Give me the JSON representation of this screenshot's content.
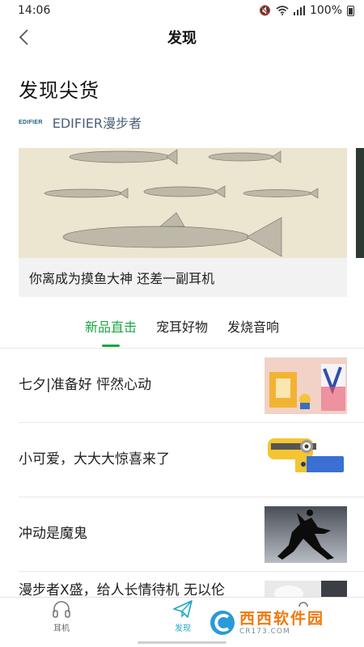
{
  "status_bar": {
    "time": "14:06",
    "battery": "100%",
    "icons": [
      "mute-icon",
      "wifi-icon",
      "signal-icon",
      "battery-icon"
    ]
  },
  "nav": {
    "title": "发现",
    "back_icon": "chevron-left-icon"
  },
  "section": {
    "title": "发现尖货"
  },
  "brand": {
    "logo_text": "EDIFIER",
    "name": "EDIFIER漫步者"
  },
  "banner": {
    "caption": "你离成为摸鱼大神 还差一副耳机"
  },
  "tabs": [
    {
      "label": "新品直击",
      "active": true
    },
    {
      "label": "宠耳好物",
      "active": false
    },
    {
      "label": "发烧音响",
      "active": false
    }
  ],
  "articles": [
    {
      "title": "七夕|准备好 怦然心动",
      "thumb": "gift-box-photo"
    },
    {
      "title": "小可爱，大大大惊喜来了",
      "thumb": "minion-speaker-photo"
    },
    {
      "title": "冲动是魔鬼",
      "thumb": "jumping-silhouette-photo"
    },
    {
      "title": "漫步者X盛，给人长情待机 无以伦",
      "thumb": "white-earbuds-photo"
    }
  ],
  "bottom_nav": [
    {
      "label": "耳机",
      "icon": "headphones-icon",
      "active": false
    },
    {
      "label": "发现",
      "icon": "paper-plane-icon",
      "active": true
    },
    {
      "label": "",
      "icon": "profile-icon",
      "active": false
    }
  ],
  "watermark": {
    "name": "西西软件园",
    "domain": "CR173.COM"
  },
  "colors": {
    "accent_green": "#1aa63f",
    "accent_blue": "#1aa7c9",
    "watermark_orange": "#f07a10"
  }
}
